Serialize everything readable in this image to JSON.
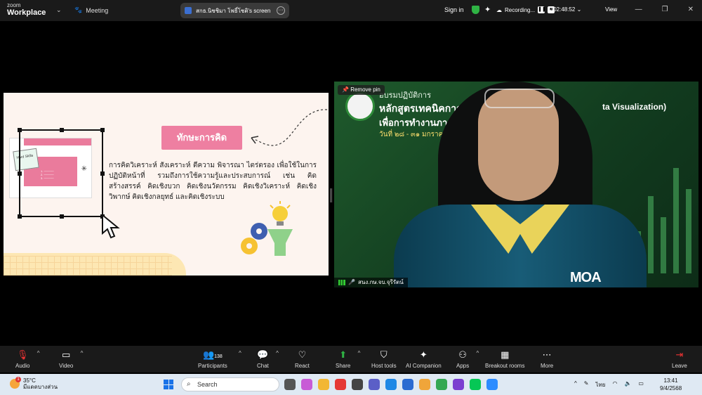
{
  "topbar": {
    "logo_top": "zoom",
    "logo_bottom": "Workplace",
    "meeting_label": "Meeting",
    "screen_share_label": "สกธ.นิชชิมา  โพธิ์โชติ's screen",
    "sign_in": "Sign in",
    "recording_label": "Recording...",
    "elapsed": "02:48:52",
    "view_label": "View"
  },
  "slide": {
    "title": "ทักษะการคิด",
    "body": "การคิดวิเคราะห์ สังเคราะห์ ตีความ พิจารณา ไตร่ตรอง เพื่อใช้ในการปฏิบัติหน้าที่ รวมถึงการใช้ความรู้และประสบการณ์ เช่น คิดสร้างสรรค์ คิดเชิงบวก คิดเชิงนวัตกรรม คิดเชิงวิเคราะห์ คิดเชิงวิพากษ์ คิดเชิงกลยุทธ์ และคิดเชิงระบบ",
    "mini_note": "Hard Skills"
  },
  "video": {
    "remove_pin": "Remove pin",
    "banner_line1": "อบรมปฏิบัติการ",
    "banner_line2": "หลักสูตรเทคนิคการ",
    "banner_line2_right": "ta Visualization)",
    "banner_line3": "เพื่อการทำงานภาค",
    "banner_line4": "วันที่ ๒๘ - ๓๑ มกราคม",
    "watermark": "MOA",
    "participant_name": "สนง.กษ.จบ.จุรีรัตน์"
  },
  "toolbar": {
    "audio": "Audio",
    "video": "Video",
    "participants": "Participants",
    "participants_count": "138",
    "chat": "Chat",
    "react": "React",
    "share": "Share",
    "host_tools": "Host tools",
    "ai_companion": "AI Companion",
    "apps": "Apps",
    "breakout_rooms": "Breakout rooms",
    "more": "More",
    "leave": "Leave"
  },
  "taskbar": {
    "temperature": "35°C",
    "weather_desc": "มีแดดบางส่วน",
    "weather_badge": "1",
    "search_placeholder": "Search",
    "lang": "ไทย",
    "time": "13:41",
    "date": "9/4/2568"
  },
  "colors": {
    "slide_title_bg": "#ee7fa1",
    "video_bg": "#1f5a2c",
    "shield_green": "#2fb344",
    "leave_red": "#e33333"
  }
}
